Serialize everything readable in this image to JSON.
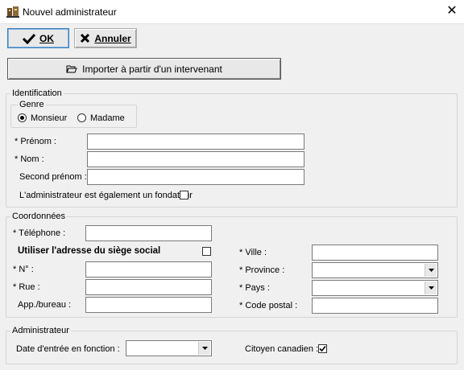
{
  "window": {
    "title": "Nouvel administrateur",
    "close_glyph": "✕",
    "icon": "app-icon"
  },
  "toolbar": {
    "ok_label": "OK",
    "ok_icon": "check-icon",
    "cancel_label": "Annuler",
    "cancel_icon": "x-icon",
    "import_label": "Importer à partir d'un intervenant",
    "import_icon": "folder-open-icon"
  },
  "identification": {
    "group_title": "Identification",
    "genre": {
      "title": "Genre",
      "options": [
        {
          "label": "Monsieur",
          "selected": true
        },
        {
          "label": "Madame",
          "selected": false
        }
      ]
    },
    "fields": {
      "prenom_label": "* Prénom :",
      "prenom_value": "",
      "nom_label": "* Nom :",
      "nom_value": "",
      "second_prenom_label": "Second prénom :",
      "second_prenom_value": ""
    },
    "fondateur_label": "L'administrateur est également un fondateur",
    "fondateur_checked": false
  },
  "coordonnees": {
    "group_title": "Coordonnées",
    "telephone_label": "* Téléphone :",
    "telephone_value": "",
    "use_siege_label": "Utiliser l'adresse du siège social",
    "use_siege_checked": false,
    "numero_label": "* N° :",
    "numero_value": "",
    "rue_label": "* Rue :",
    "rue_value": "",
    "app_label": "App./bureau :",
    "app_value": "",
    "ville_label": "* Ville :",
    "ville_value": "",
    "province_label": "* Province :",
    "province_value": "",
    "pays_label": "* Pays :",
    "pays_value": "",
    "code_postal_label": "* Code postal :",
    "code_postal_value": ""
  },
  "administrateur": {
    "group_title": "Administrateur",
    "date_label": "Date d'entrée en fonction :",
    "date_value": "",
    "citoyen_label": "Citoyen canadien :",
    "citoyen_checked": true
  },
  "colors": {
    "window_bg": "#f0f0f0",
    "input_border": "#7a7a7a",
    "group_border": "#d5d5d5",
    "focus_border": "#3c7fb1"
  }
}
